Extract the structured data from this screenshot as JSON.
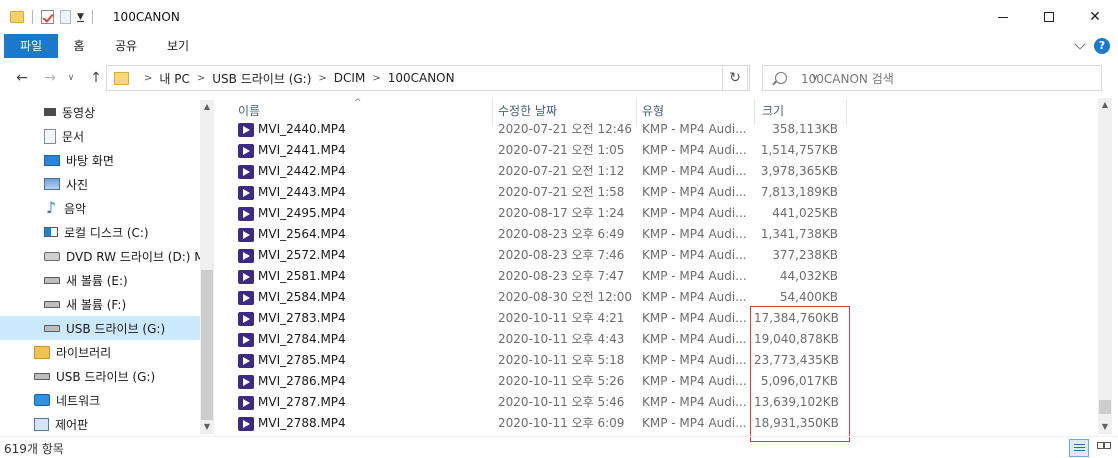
{
  "window": {
    "title": "100CANON"
  },
  "ribbon": {
    "tabs": [
      "파일",
      "홈",
      "공유",
      "보기"
    ]
  },
  "address": {
    "crumbs": [
      "내 PC",
      "USB 드라이브 (G:)",
      "DCIM",
      "100CANON"
    ]
  },
  "search": {
    "placeholder": "100CANON 검색"
  },
  "nav_pane": {
    "items": [
      {
        "label": "동영상",
        "icon": "video-icon"
      },
      {
        "label": "문서",
        "icon": "document-icon"
      },
      {
        "label": "바탕 화면",
        "icon": "desktop-icon"
      },
      {
        "label": "사진",
        "icon": "pictures-icon"
      },
      {
        "label": "음악",
        "icon": "music-icon"
      },
      {
        "label": "로컬 디스크 (C:)",
        "icon": "windows-drive-icon"
      },
      {
        "label": "DVD RW 드라이브 (D:) M",
        "icon": "dvd-drive-icon"
      },
      {
        "label": "새 볼륨 (E:)",
        "icon": "drive-icon"
      },
      {
        "label": "새 볼륨 (F:)",
        "icon": "drive-icon"
      },
      {
        "label": "USB 드라이브 (G:)",
        "icon": "usb-drive-icon"
      },
      {
        "label": "라이브러리",
        "icon": "library-icon"
      },
      {
        "label": "USB 드라이브 (G:)",
        "icon": "usb-drive-icon"
      },
      {
        "label": "네트워크",
        "icon": "network-icon"
      },
      {
        "label": "제어판",
        "icon": "control-panel-icon"
      }
    ]
  },
  "columns": {
    "name": "이름",
    "date": "수정한 날짜",
    "type": "유형",
    "size": "크기"
  },
  "files": [
    {
      "name": "MVI_2440.MP4",
      "date": "2020-07-21 오전 12:46",
      "type": "KMP - MP4 Audi...",
      "size": "358,113KB"
    },
    {
      "name": "MVI_2441.MP4",
      "date": "2020-07-21 오전 1:05",
      "type": "KMP - MP4 Audi...",
      "size": "1,514,757KB"
    },
    {
      "name": "MVI_2442.MP4",
      "date": "2020-07-21 오전 1:12",
      "type": "KMP - MP4 Audi...",
      "size": "3,978,365KB"
    },
    {
      "name": "MVI_2443.MP4",
      "date": "2020-07-21 오전 1:58",
      "type": "KMP - MP4 Audi...",
      "size": "7,813,189KB"
    },
    {
      "name": "MVI_2495.MP4",
      "date": "2020-08-17 오후 1:24",
      "type": "KMP - MP4 Audi...",
      "size": "441,025KB"
    },
    {
      "name": "MVI_2564.MP4",
      "date": "2020-08-23 오후 6:49",
      "type": "KMP - MP4 Audi...",
      "size": "1,341,738KB"
    },
    {
      "name": "MVI_2572.MP4",
      "date": "2020-08-23 오후 7:46",
      "type": "KMP - MP4 Audi...",
      "size": "377,238KB"
    },
    {
      "name": "MVI_2581.MP4",
      "date": "2020-08-23 오후 7:47",
      "type": "KMP - MP4 Audi...",
      "size": "44,032KB"
    },
    {
      "name": "MVI_2584.MP4",
      "date": "2020-08-30 오전 12:00",
      "type": "KMP - MP4 Audi...",
      "size": "54,400KB"
    },
    {
      "name": "MVI_2783.MP4",
      "date": "2020-10-11 오후 4:21",
      "type": "KMP - MP4 Audi...",
      "size": "17,384,760KB"
    },
    {
      "name": "MVI_2784.MP4",
      "date": "2020-10-11 오후 4:43",
      "type": "KMP - MP4 Audi...",
      "size": "19,040,878KB"
    },
    {
      "name": "MVI_2785.MP4",
      "date": "2020-10-11 오후 5:18",
      "type": "KMP - MP4 Audi...",
      "size": "23,773,435KB"
    },
    {
      "name": "MVI_2786.MP4",
      "date": "2020-10-11 오후 5:26",
      "type": "KMP - MP4 Audi...",
      "size": "5,096,017KB"
    },
    {
      "name": "MVI_2787.MP4",
      "date": "2020-10-11 오후 5:46",
      "type": "KMP - MP4 Audi...",
      "size": "13,639,102KB"
    },
    {
      "name": "MVI_2788.MP4",
      "date": "2020-10-11 오후 6:09",
      "type": "KMP - MP4 Audi...",
      "size": "18,931,350KB"
    }
  ],
  "status": {
    "item_count": "619개 항목"
  },
  "colors": {
    "accent": "#1979ca",
    "selection": "#cce8ff",
    "highlight_box": "#e03a3a"
  }
}
